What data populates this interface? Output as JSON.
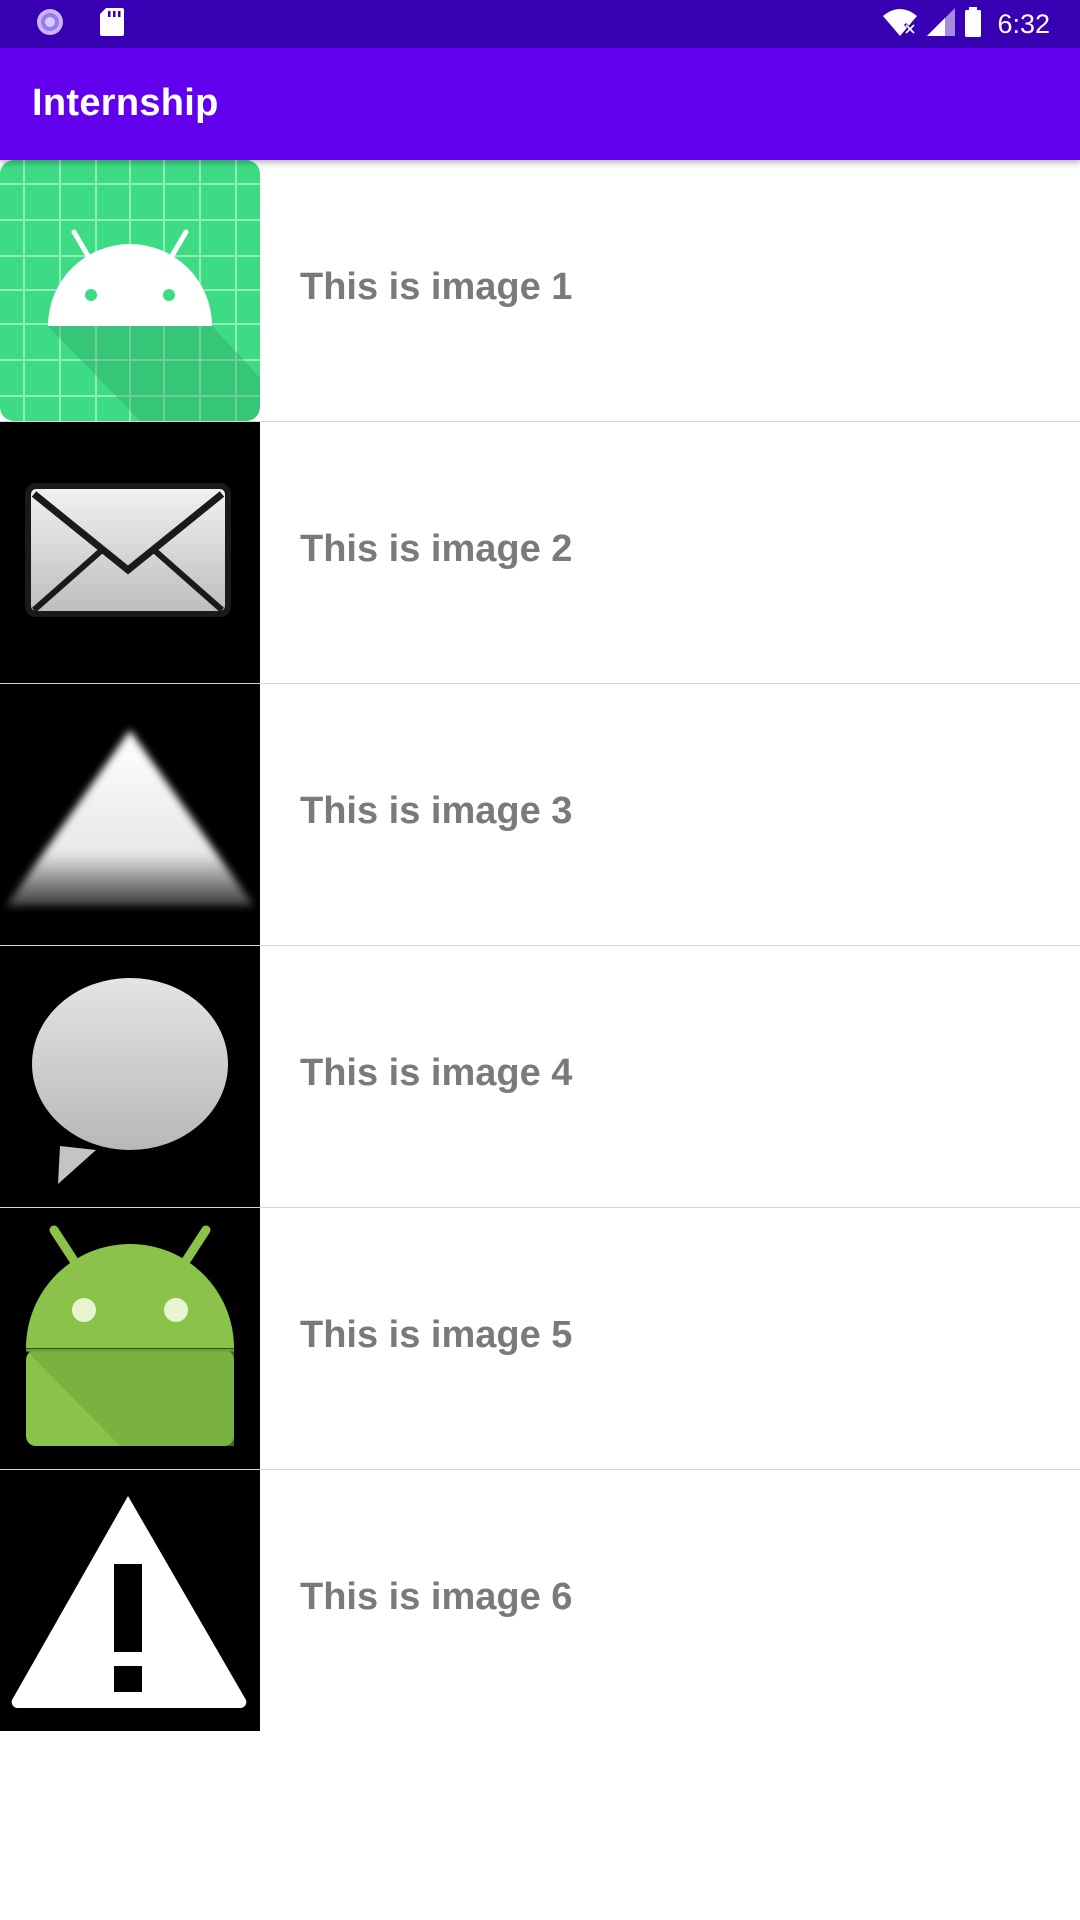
{
  "status_bar": {
    "time": "6:32",
    "left_icons": [
      "app-indicator-icon",
      "sd-card-icon"
    ],
    "right_icons": [
      "wifi-icon",
      "signal-icon",
      "battery-icon"
    ],
    "background": "#3700b3"
  },
  "app_bar": {
    "title": "Internship",
    "background": "#6200ee"
  },
  "list": {
    "items": [
      {
        "label": "This is image 1",
        "icon": "android-launcher-icon"
      },
      {
        "label": "This is image 2",
        "icon": "email-icon"
      },
      {
        "label": "This is image 3",
        "icon": "triangle-up-icon"
      },
      {
        "label": "This is image 4",
        "icon": "chat-bubble-icon"
      },
      {
        "label": "This is image 5",
        "icon": "android-robot-icon"
      },
      {
        "label": "This is image 6",
        "icon": "warning-icon"
      }
    ]
  }
}
